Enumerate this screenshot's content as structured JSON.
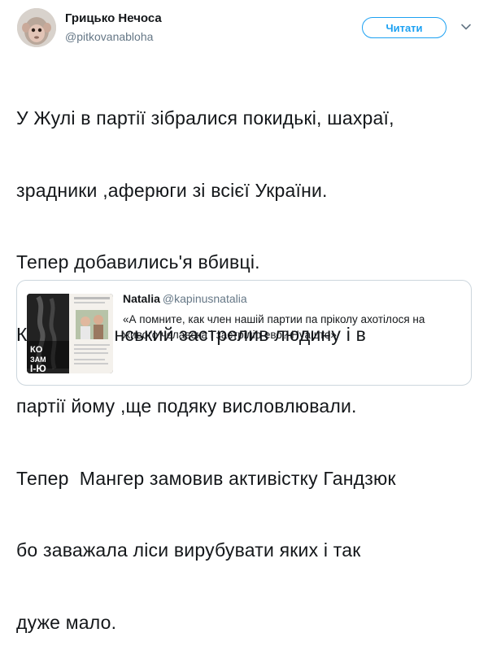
{
  "author": {
    "name": "Грицько Нечоса",
    "handle": "@pitkovanabloha"
  },
  "follow_label": "Читати",
  "tweet_lines": [
    "У Жулі в партії зібралися покидькі, шахраї,",
    "зрадники ,аферюги зі всієї України.",
    "Тепер добавились'я вбивці.",
    "Князь Лозинський застрелив людину і в",
    "партії йому ,ще подяку висловлювали.",
    "Тепер  Мангер замовив активістку Гандзюк",
    "бо заважала ліси вирубувати яких і так",
    "дуже мало."
  ],
  "quoted": {
    "name": "Natalia",
    "handle": "@kapinusnatalia",
    "text": "«А помните, как член нашій партии па пріколу ахотілося на живого чєлавєка і застрілір ево? Нуашто»"
  },
  "icons": {
    "menu": "chevron-down-icon"
  },
  "colors": {
    "accent": "#1da1f2",
    "muted": "#657786",
    "border": "#ccd6dd"
  }
}
